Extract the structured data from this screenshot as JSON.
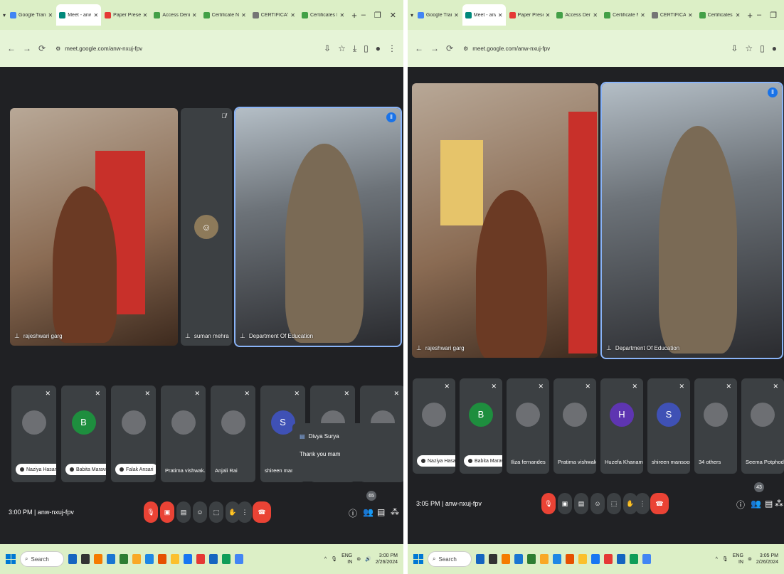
{
  "left": {
    "tabs": [
      {
        "label": "Google Translate",
        "icon": "google-translate-icon",
        "color": "#4285f4"
      },
      {
        "label": "Meet - anw",
        "icon": "meet-icon",
        "color": "#00897b",
        "active": true
      },
      {
        "label": "Paper Presentat",
        "icon": "paper-icon",
        "color": "#e53935"
      },
      {
        "label": "Access Denied",
        "icon": "access-icon",
        "color": "#43a047"
      },
      {
        "label": "Certificate NEP",
        "icon": "certificate-icon",
        "color": "#43a047"
      },
      {
        "label": "CERTIFICATE-NI",
        "icon": "certificate-icon",
        "color": "#757575"
      },
      {
        "label": "Certificates NEP",
        "icon": "certificate-icon",
        "color": "#43a047"
      }
    ],
    "url": "meet.google.com/anw-nxuj-fpv",
    "big_tiles": [
      {
        "name": "rajeshwari garg"
      },
      {
        "name": "suman mehra"
      },
      {
        "name": "Department Of Education"
      }
    ],
    "small_tiles": [
      {
        "name": "Naziya Hasan",
        "type": "chip"
      },
      {
        "name": "Babita Maravi",
        "type": "chip",
        "initial": "B",
        "color": "#1e8e3e"
      },
      {
        "name": "Falak Ansari",
        "type": "chip"
      },
      {
        "name": "Pratima vishwak...",
        "type": "text"
      },
      {
        "name": "Anjali Rai",
        "type": "text"
      },
      {
        "name": "shireen mansoori",
        "type": "text",
        "initial": "S",
        "color": "#3f51b5"
      },
      {
        "name": "",
        "type": "text"
      },
      {
        "name": "",
        "type": "text"
      }
    ],
    "popover": {
      "name": "Divya Surya",
      "message": "Thank you mam"
    },
    "time": "3:00 PM",
    "code": "anw-nxuj-fpv",
    "people_count": "65",
    "clock_time": "3:00 PM",
    "clock_date": "2/26/2024"
  },
  "right": {
    "tabs": [
      {
        "label": "Google Translate",
        "icon": "google-translate-icon",
        "color": "#4285f4"
      },
      {
        "label": "Meet - anw",
        "icon": "meet-icon",
        "color": "#00897b",
        "active": true
      },
      {
        "label": "Paper Presentat",
        "icon": "paper-icon",
        "color": "#e53935"
      },
      {
        "label": "Access Denied",
        "icon": "access-icon",
        "color": "#43a047"
      },
      {
        "label": "Certificate NEP",
        "icon": "certificate-icon",
        "color": "#43a047"
      },
      {
        "label": "CERTIFICATE-NI",
        "icon": "certificate-icon",
        "color": "#757575"
      },
      {
        "label": "Certificates NEP",
        "icon": "certificate-icon",
        "color": "#43a047"
      }
    ],
    "url": "meet.google.com/anw-nxuj-fpv",
    "big_tiles": [
      {
        "name": "rajeshwari garg"
      },
      {
        "name": "Department Of Education"
      }
    ],
    "small_tiles": [
      {
        "name": "Naziya Hasan",
        "type": "chip"
      },
      {
        "name": "Babita Maravi",
        "type": "chip",
        "initial": "B",
        "color": "#1e8e3e"
      },
      {
        "name": "Iliza fernandes",
        "type": "text"
      },
      {
        "name": "Pratima vishwak...",
        "type": "text"
      },
      {
        "name": "Huzefa Khanam",
        "type": "text",
        "initial": "H",
        "color": "#5e35b1"
      },
      {
        "name": "shireen mansoori",
        "type": "text",
        "initial": "S",
        "color": "#3f51b5"
      },
      {
        "name": "34 others",
        "type": "text"
      },
      {
        "name": "Seema Potphode",
        "type": "text"
      }
    ],
    "time": "3:05 PM",
    "code": "anw-nxuj-fpv",
    "people_count": "43",
    "clock_time": "3:05 PM",
    "clock_date": "2/26/2024"
  },
  "common": {
    "search_label": "Search",
    "lang_top": "ENG",
    "lang_bottom": "IN"
  }
}
